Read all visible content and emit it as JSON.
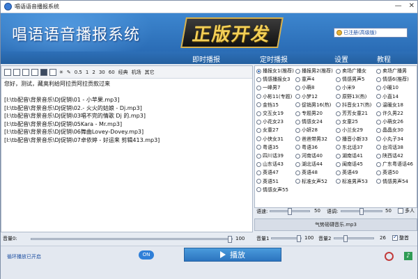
{
  "window": {
    "title": "唱语语音播报系统"
  },
  "banner": {
    "app_title": "唱语语音播报系统",
    "logo_text": "正版开发",
    "registration_text": "已注册(高级版)"
  },
  "menu": {
    "items": [
      "即时播报",
      "定时播报",
      "设置",
      "教程"
    ]
  },
  "toolbar": {
    "labels": [
      "0.5",
      "1",
      "2",
      "30",
      "60",
      "经典",
      "机场",
      "其它"
    ]
  },
  "editor": {
    "lines": [
      "您好，测试，藏奥利给阿拉贡阿拉贡款过来",
      "",
      "[I:\\tb配音\\背景音乐\\DJ促销\\01 - 小苹果.mp3]",
      "[I:\\tb配音\\背景音乐\\DJ促销\\02.- 火火的姑娘 - Dj.mp3]",
      "[I:\\tb配音\\背景音乐\\DJ促销\\03唱不完的情歌 Dj 的.mp3]",
      "[I:\\tb配音\\背景音乐\\DJ促销\\05Kara - Mr.mp3]",
      "[I:\\tb配音\\背景音乐\\DJ促销\\06舞曲Lovey-Dovey.mp3]",
      "[I:\\tb配音\\背景音乐\\DJ促销\\07卓依婷 - 好运来 剪辑413.mp3]"
    ]
  },
  "left_volume": {
    "label": "音量0:",
    "value": "100",
    "level": 100
  },
  "voices": [
    "播报女1(推荐)",
    "播报男2(推荐)",
    "卖场广播女",
    "卖场广播男",
    "情感播报女3",
    "童声4",
    "情感男声5",
    "情感6(推荐)",
    "一峰男7",
    "小萌8",
    "小米9",
    "小暖10",
    "小彬11(专题)",
    "小梦12",
    "原野13(热)",
    "小直14",
    "金铛15",
    "促销男16(热)",
    "抖音女17(热)",
    "温暖女18",
    "交互女19",
    "专题男20",
    "芳芳女童21",
    "许久男22",
    "小花女23",
    "情感女24",
    "女童25",
    "小萌女26",
    "女童27",
    "小妍28",
    "小兰女29",
    "晶晶女30",
    "小侠女31",
    "爸爸带男32",
    "播音小新33",
    "小丸子34",
    "粤语35",
    "粤语36",
    "东北话37",
    "台湾话38",
    "四川话39",
    "河南话40",
    "湖南话41",
    "陕西话42",
    "山东话43",
    "湖北话44",
    "闽南话45",
    "广东粤语话46",
    "英语47",
    "英语48",
    "英语49",
    "英语50",
    "英语51",
    "标准女声52",
    "标准男声53",
    "情感男声54",
    "情感女声55"
  ],
  "selected_voice": 0,
  "speech": {
    "speed_label": "语速:",
    "speed_value": "50",
    "speed_level": 50,
    "pitch_label": "语调:",
    "pitch_value": "50",
    "pitch_level": 50,
    "multi_label": "多人"
  },
  "bgm": {
    "file": "气势磅礴音乐.mp3"
  },
  "right_volume": {
    "vol1_label": "音量1",
    "vol1_value": "100",
    "vol1_level": 100,
    "vol2_label": "音量2",
    "vol2_value": "26",
    "vol2_level": 26,
    "reorder_label": "整首"
  },
  "bottom": {
    "loop_label": "循环播放已开启",
    "toggle_label": "ON",
    "play_label": "播放"
  }
}
